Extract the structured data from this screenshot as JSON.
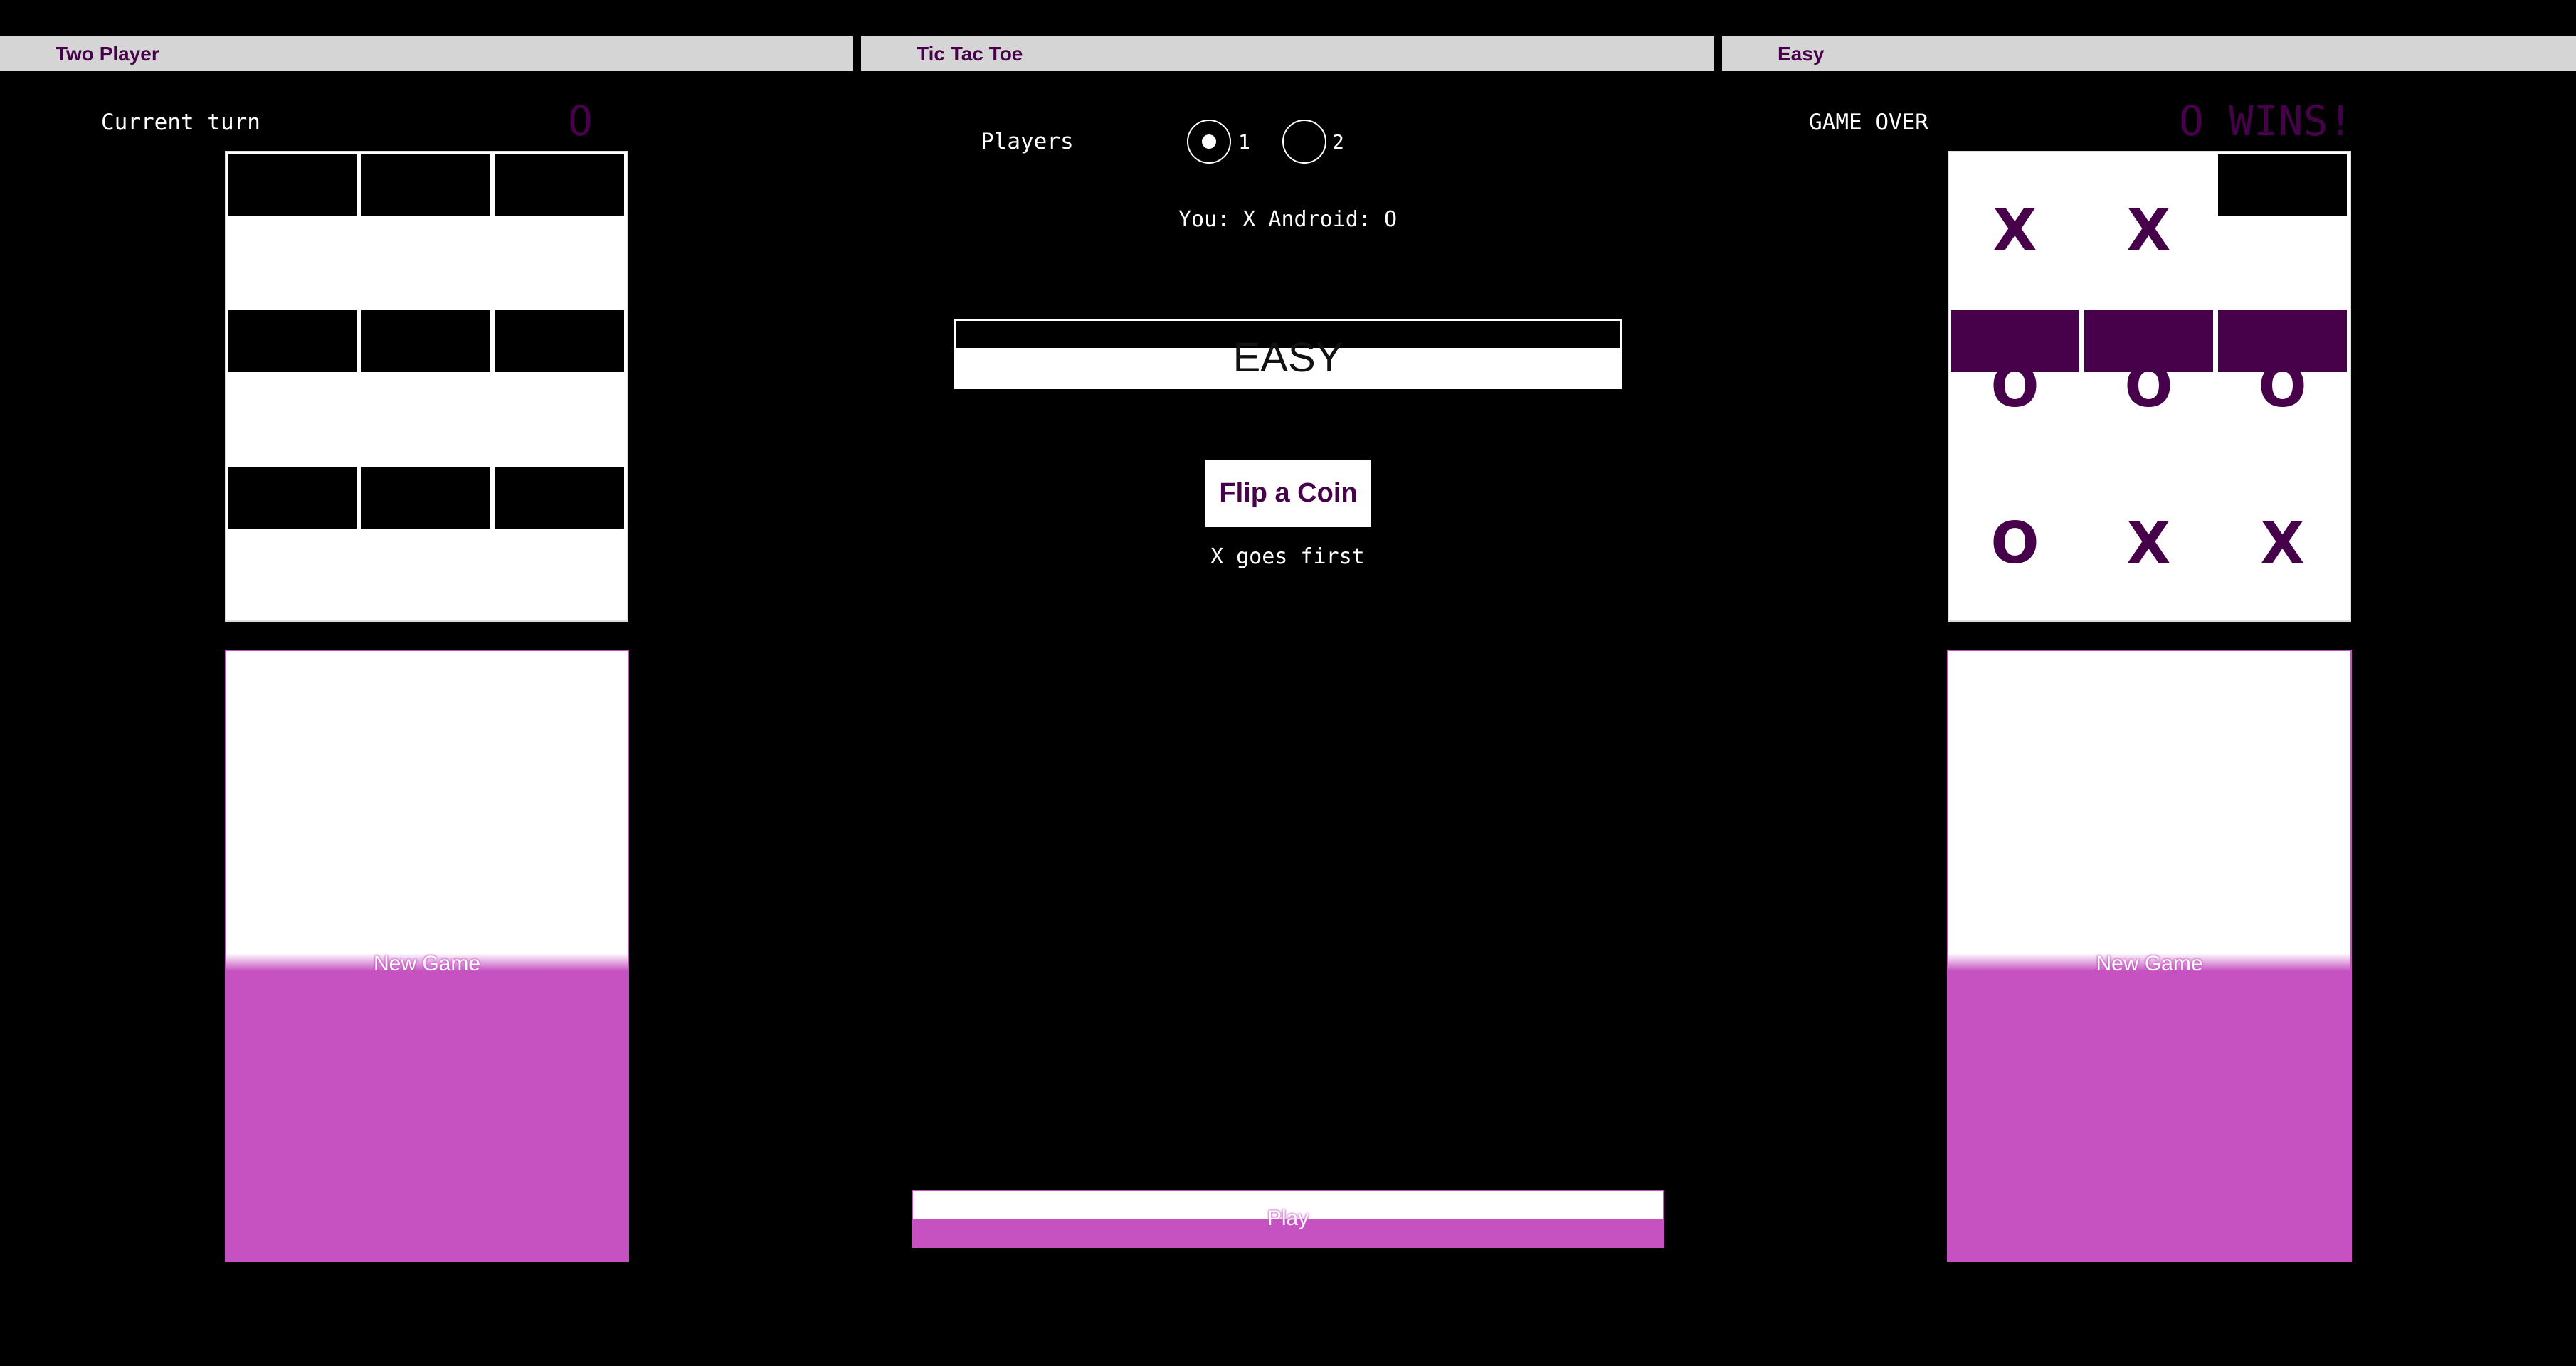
{
  "colors": {
    "accent_purple": "#47004a",
    "button_magenta": "#c652c2",
    "background": "#000000",
    "titlebar_gray": "#d5d5d5"
  },
  "panels": {
    "left": {
      "title": "Two Player",
      "status_label": "Current turn",
      "status_value": "O",
      "board": [
        "",
        "",
        "",
        "",
        "",
        "",
        "",
        "",
        ""
      ],
      "new_game_label": "New Game"
    },
    "center": {
      "title": "Tic Tac Toe",
      "players_label": "Players",
      "player_options": [
        "1",
        "2"
      ],
      "selected_players": "1",
      "assignment_text": "You: X Android: O",
      "difficulty_value": "EASY",
      "flip_label": "Flip a Coin",
      "flip_result": "X goes first",
      "play_label": "Play"
    },
    "right": {
      "title": "Easy",
      "status_label": "GAME OVER",
      "status_value": "O WINS!",
      "board": [
        "X",
        "X",
        "",
        "O",
        "O",
        "O",
        "O",
        "X",
        "X"
      ],
      "winning_row": 1,
      "new_game_label": "New Game"
    }
  }
}
